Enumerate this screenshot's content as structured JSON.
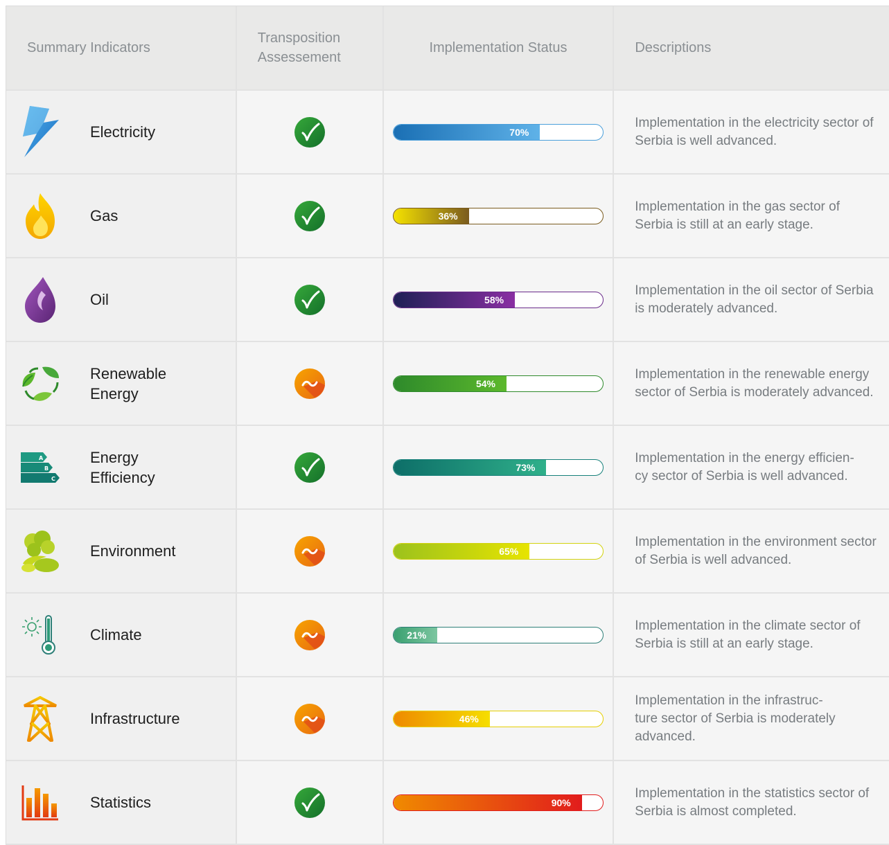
{
  "header": {
    "col1": "Summary Indicators",
    "col2": "Transposition\nAssessement",
    "col3": "Implementation Status",
    "col4": "Descriptions"
  },
  "rows": [
    {
      "name": "Electricity",
      "icon": "lightning-icon",
      "assessment": "check",
      "progress": 0.7,
      "progress_label": "70%",
      "color_start": "#1a6fb4",
      "color_end": "#5fb2e8",
      "border": "#4a9fdb",
      "description": "Implementation in the electricity sector of Serbia is well advanced."
    },
    {
      "name": "Gas",
      "icon": "flame-icon",
      "assessment": "check",
      "progress": 0.36,
      "progress_label": "36%",
      "color_start": "#f5e200",
      "color_end": "#7a5b1e",
      "border": "#7a5b1e",
      "description": "Implementation in the gas sector of Serbia is still at an early stage."
    },
    {
      "name": "Oil",
      "icon": "oil-drop-icon",
      "assessment": "check",
      "progress": 0.58,
      "progress_label": "58%",
      "color_start": "#1e2055",
      "color_end": "#8a2fa3",
      "border": "#6a2b8a",
      "description": "Implementation in the oil sector of Serbia is moderately advanced."
    },
    {
      "name": "Renewable\nEnergy",
      "icon": "recycle-leaves-icon",
      "assessment": "partial",
      "progress": 0.54,
      "progress_label": "54%",
      "color_start": "#2e8a2b",
      "color_end": "#5cb82c",
      "border": "#2e8a2b",
      "description": "Implementation in the renewable energy sector of Serbia is moderately advanced."
    },
    {
      "name": "Energy\nEfficiency",
      "icon": "energy-rating-icon",
      "assessment": "check",
      "progress": 0.73,
      "progress_label": "73%",
      "color_start": "#0d6e68",
      "color_end": "#2fb08a",
      "border": "#16807a",
      "description": "Implementation in the energy efficien-\ncy sector of Serbia is well advanced."
    },
    {
      "name": "Environment",
      "icon": "trees-icon",
      "assessment": "partial",
      "progress": 0.65,
      "progress_label": "65%",
      "color_start": "#9cc21c",
      "color_end": "#e7e400",
      "border": "#d2d20c",
      "description": "Implementation in the environment sector of Serbia is well advanced."
    },
    {
      "name": "Climate",
      "icon": "thermometer-icon",
      "assessment": "partial",
      "progress": 0.21,
      "progress_label": "21%",
      "color_start": "#3aa070",
      "color_end": "#7cc6a0",
      "border": "#2e7f78",
      "description": "Implementation in the climate sector of Serbia is still at an early stage."
    },
    {
      "name": "Infrastructure",
      "icon": "power-tower-icon",
      "assessment": "partial",
      "progress": 0.46,
      "progress_label": "46%",
      "color_start": "#ee8a00",
      "color_end": "#f6de00",
      "border": "#e6cf00",
      "description": "Implementation in the infrastruc-\nture sector of Serbia is moderately\nadvanced."
    },
    {
      "name": "Statistics",
      "icon": "bar-chart-icon",
      "assessment": "check",
      "progress": 0.9,
      "progress_label": "90%",
      "color_start": "#f08a00",
      "color_end": "#e11c1c",
      "border": "#e11c1c",
      "description": "Implementation in the statistics sector of Serbia is almost completed."
    }
  ],
  "colors": {
    "check": "#1e8a2c",
    "partial": "#f08a00"
  }
}
